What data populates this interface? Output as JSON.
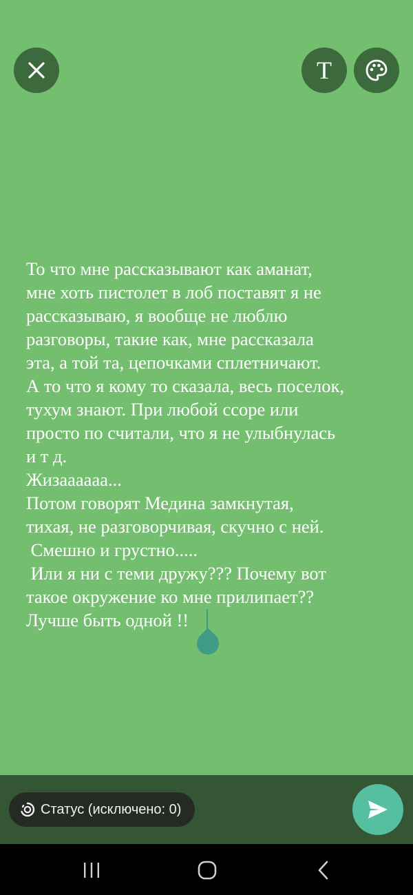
{
  "editor": {
    "text": "То что мне рассказывают как аманат,\nмне хоть пистолет в лоб поставят я не\nрассказываю, я вообще не люблю\nразговоры, такие как, мне рассказала\nэта, а той та, цепочками сплетничают.\nА то что я кому то сказала, весь поселок,\nтухум знают. При любой ссоре или\nпросто по считали, что я не улыбнулась\nи т д.\nЖизаааааа...\nПотом говорят Медина замкнутая,\nтихая, не разговорчивая, скучно с ней.\n Смешно и грустно.....\n Или я ни с теми дружу??? Почему вот\nтакое окружение ко мне прилипает??\nЛучше быть одной !!",
    "background_color": "#74bf6f",
    "text_color": "#ffffff"
  },
  "toolbar": {
    "close_icon": "close-icon",
    "text_button_label": "T",
    "palette_icon": "palette-icon"
  },
  "footer": {
    "status_chip_label": "Статус (исключено: 0)",
    "status_icon": "status-ring-icon",
    "send_icon": "send-icon",
    "send_color": "#55bf9f"
  },
  "navigation": {
    "recents_icon": "recents-icon",
    "home_icon": "home-icon",
    "back_icon": "back-icon"
  }
}
